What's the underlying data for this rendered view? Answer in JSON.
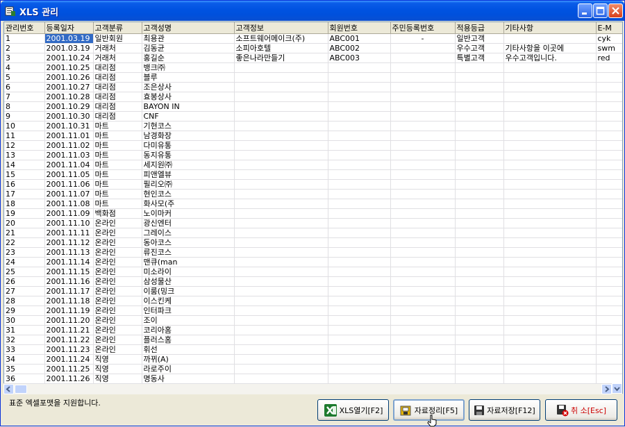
{
  "window": {
    "title": "XLS 관리"
  },
  "table": {
    "columns": [
      "관리번호",
      "등록일자",
      "고객분류",
      "고객성명",
      "고객정보",
      "회원번호",
      "주민등록번호",
      "적용등급",
      "기타사항",
      "E-M"
    ],
    "rows": [
      [
        "1",
        "2001.03.19",
        "일반회원",
        "최용관",
        "소프트웨어메이크(주)",
        "ABC001",
        "-",
        "일반고객",
        "",
        "cyk"
      ],
      [
        "2",
        "2001.03.19",
        "거래처",
        "김동균",
        "소피아호텔",
        "ABC002",
        "",
        "우수고객",
        "기타사항을 이곳에",
        "swm"
      ],
      [
        "3",
        "2001.10.24",
        "거래처",
        "홍길순",
        "좋은나라만들기",
        "ABC003",
        "",
        "특별고객",
        "우수고객입니다.",
        "red"
      ],
      [
        "4",
        "2001.10.25",
        "대리점",
        "뱅크㈜",
        "",
        "",
        "",
        "",
        "",
        ""
      ],
      [
        "5",
        "2001.10.26",
        "대리점",
        "블루",
        "",
        "",
        "",
        "",
        "",
        ""
      ],
      [
        "6",
        "2001.10.27",
        "대리점",
        "조은상사",
        "",
        "",
        "",
        "",
        "",
        ""
      ],
      [
        "7",
        "2001.10.28",
        "대리점",
        "효봉상사",
        "",
        "",
        "",
        "",
        "",
        ""
      ],
      [
        "8",
        "2001.10.29",
        "대리점",
        "BAYON IN",
        "",
        "",
        "",
        "",
        "",
        ""
      ],
      [
        "9",
        "2001.10.30",
        "대리점",
        "CNF",
        "",
        "",
        "",
        "",
        "",
        ""
      ],
      [
        "10",
        "2001.10.31",
        "마트",
        "기현코스",
        "",
        "",
        "",
        "",
        "",
        ""
      ],
      [
        "11",
        "2001.11.01",
        "마트",
        "남경화장",
        "",
        "",
        "",
        "",
        "",
        ""
      ],
      [
        "12",
        "2001.11.02",
        "마트",
        "다미유통",
        "",
        "",
        "",
        "",
        "",
        ""
      ],
      [
        "13",
        "2001.11.03",
        "마트",
        "동지유통",
        "",
        "",
        "",
        "",
        "",
        ""
      ],
      [
        "14",
        "2001.11.04",
        "마트",
        "세지원㈜",
        "",
        "",
        "",
        "",
        "",
        ""
      ],
      [
        "15",
        "2001.11.05",
        "마트",
        "피앤엘뷰",
        "",
        "",
        "",
        "",
        "",
        ""
      ],
      [
        "16",
        "2001.11.06",
        "마트",
        "필리오㈜",
        "",
        "",
        "",
        "",
        "",
        ""
      ],
      [
        "17",
        "2001.11.07",
        "마트",
        "현인코스",
        "",
        "",
        "",
        "",
        "",
        ""
      ],
      [
        "18",
        "2001.11.08",
        "마트",
        "화사모(주",
        "",
        "",
        "",
        "",
        "",
        ""
      ],
      [
        "19",
        "2001.11.09",
        "백화점",
        "노이마커",
        "",
        "",
        "",
        "",
        "",
        ""
      ],
      [
        "20",
        "2001.11.10",
        "온라인",
        "광신엔터",
        "",
        "",
        "",
        "",
        "",
        ""
      ],
      [
        "21",
        "2001.11.11",
        "온라인",
        "그레이스",
        "",
        "",
        "",
        "",
        "",
        ""
      ],
      [
        "22",
        "2001.11.12",
        "온라인",
        "동아코스",
        "",
        "",
        "",
        "",
        "",
        ""
      ],
      [
        "23",
        "2001.11.13",
        "온라인",
        "류진코스",
        "",
        "",
        "",
        "",
        "",
        ""
      ],
      [
        "24",
        "2001.11.14",
        "온라인",
        "맨큐(man",
        "",
        "",
        "",
        "",
        "",
        ""
      ],
      [
        "25",
        "2001.11.15",
        "온라인",
        "미소라이",
        "",
        "",
        "",
        "",
        "",
        ""
      ],
      [
        "26",
        "2001.11.16",
        "온라인",
        "삼성물산",
        "",
        "",
        "",
        "",
        "",
        ""
      ],
      [
        "27",
        "2001.11.17",
        "온라인",
        "이룸(밍크",
        "",
        "",
        "",
        "",
        "",
        ""
      ],
      [
        "28",
        "2001.11.18",
        "온라인",
        "이스킨케",
        "",
        "",
        "",
        "",
        "",
        ""
      ],
      [
        "29",
        "2001.11.19",
        "온라인",
        "인터파크",
        "",
        "",
        "",
        "",
        "",
        ""
      ],
      [
        "30",
        "2001.11.20",
        "온라인",
        "조이",
        "",
        "",
        "",
        "",
        "",
        ""
      ],
      [
        "31",
        "2001.11.21",
        "온라인",
        "코리아홈",
        "",
        "",
        "",
        "",
        "",
        ""
      ],
      [
        "32",
        "2001.11.22",
        "온라인",
        "플러스홈",
        "",
        "",
        "",
        "",
        "",
        ""
      ],
      [
        "33",
        "2001.11.23",
        "온라인",
        "휘선",
        "",
        "",
        "",
        "",
        "",
        ""
      ],
      [
        "34",
        "2001.11.24",
        "직영",
        "까뀌(A)",
        "",
        "",
        "",
        "",
        "",
        ""
      ],
      [
        "35",
        "2001.11.25",
        "직영",
        "라로주이",
        "",
        "",
        "",
        "",
        "",
        ""
      ],
      [
        "36",
        "2001.11.26",
        "직영",
        "명동사",
        "",
        "",
        "",
        "",
        "",
        ""
      ]
    ]
  },
  "status": {
    "text": "표준 엑셀포맷을 지원합니다."
  },
  "buttons": {
    "xls_open": "XLS열기[F2]",
    "organize": "자료정리[F5]",
    "save": "자료저장[F12]",
    "cancel": "취 소[Esc]"
  },
  "icons": {
    "app": "spreadsheet-icon",
    "xls_open": "excel-icon",
    "organize": "floppy-folder-icon",
    "save": "floppy-icon",
    "cancel": "floppy-cancel-icon"
  }
}
